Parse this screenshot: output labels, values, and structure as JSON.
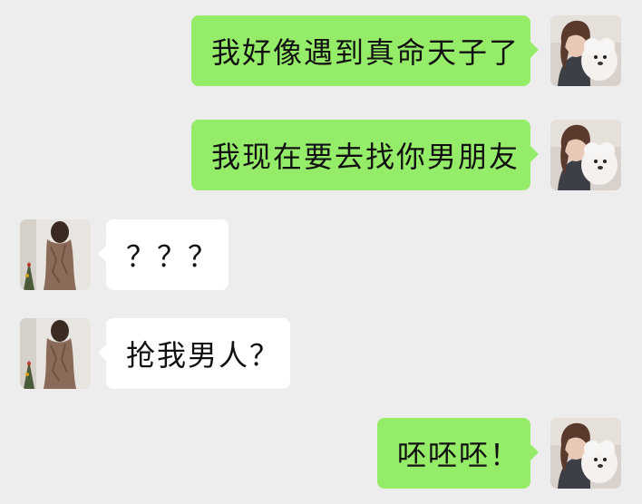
{
  "colors": {
    "background": "#ededed",
    "sent_bubble": "#95ec69",
    "received_bubble": "#ffffff"
  },
  "messages": [
    {
      "sender": "me",
      "text": "我好像遇到真命天子了",
      "avatar": "boy-with-white-dog-avatar"
    },
    {
      "sender": "me",
      "text": "我现在要去找你男朋友",
      "avatar": "boy-with-white-dog-avatar"
    },
    {
      "sender": "them",
      "text": "？？？",
      "avatar": "girl-in-dress-avatar"
    },
    {
      "sender": "them",
      "text": "抢我男人？",
      "avatar": "girl-in-dress-avatar"
    },
    {
      "sender": "me",
      "text": "呸呸呸！",
      "avatar": "boy-with-white-dog-avatar"
    }
  ]
}
